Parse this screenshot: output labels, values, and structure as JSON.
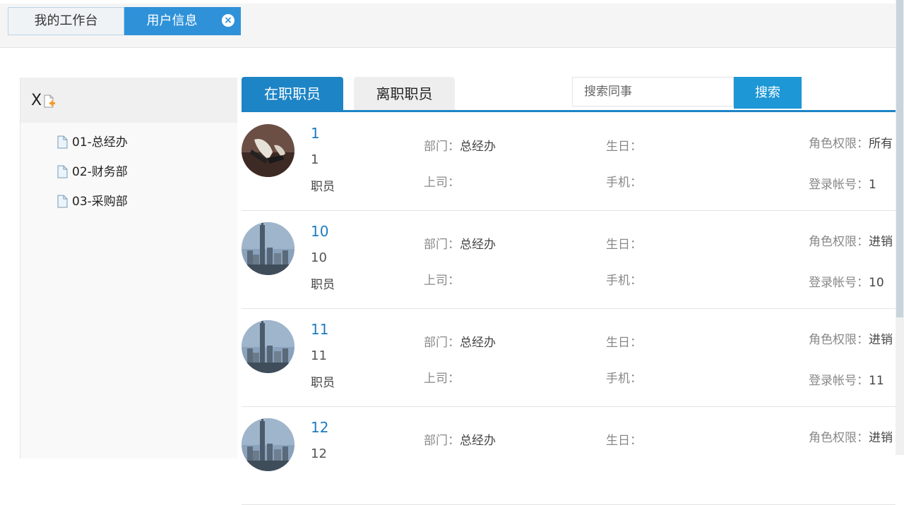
{
  "top_tabs": [
    {
      "label": "我的工作台"
    },
    {
      "label": "用户信息"
    }
  ],
  "tree": {
    "root_label": "X",
    "items": [
      {
        "label": "01-总经办"
      },
      {
        "label": "02-财务部"
      },
      {
        "label": "03-采购部"
      }
    ]
  },
  "staff_tabs": [
    {
      "label": "在职职员",
      "active": true
    },
    {
      "label": "离职职员",
      "active": false
    }
  ],
  "search": {
    "placeholder": "搜索同事",
    "button_label": "搜索"
  },
  "labels": {
    "dept": "部门：",
    "boss": "上司：",
    "birthday": "生日：",
    "phone": "手机：",
    "role": "角色权限：",
    "account": "登录帐号："
  },
  "users": [
    {
      "name": "1",
      "id": "1",
      "title": "职员",
      "dept": "总经办",
      "role": "所有",
      "account": "1",
      "avatar": "shoes-photo"
    },
    {
      "name": "10",
      "id": "10",
      "title": "职员",
      "dept": "总经办",
      "role": "进销",
      "account": "10",
      "avatar": "city-photo"
    },
    {
      "name": "11",
      "id": "11",
      "title": "职员",
      "dept": "总经办",
      "role": "进销",
      "account": "11",
      "avatar": "city-photo"
    },
    {
      "name": "12",
      "id": "12",
      "title": "",
      "dept": "总经办",
      "role": "进销",
      "account": "",
      "avatar": "city-photo"
    }
  ],
  "colors": {
    "accent": "#1d84c6",
    "tab_active": "#2f92d9",
    "search_button": "#1d97d5",
    "link": "#1d7bbf"
  }
}
